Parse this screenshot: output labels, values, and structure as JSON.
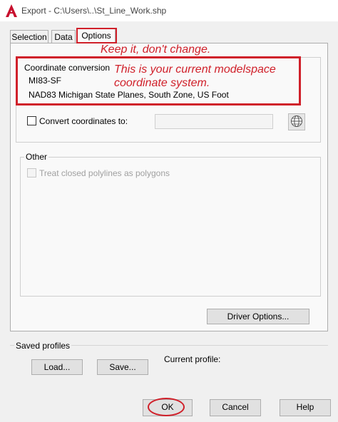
{
  "window": {
    "title": "Export - C:\\Users\\..\\St_Line_Work.shp"
  },
  "tabs": [
    {
      "label": "Selection"
    },
    {
      "label": "Data"
    },
    {
      "label": "Options",
      "selected": true
    }
  ],
  "coordinate_conversion": {
    "label": "Coordinate conversion",
    "code": "MI83-SF",
    "name": "NAD83 Michigan State Planes, South Zone, US Foot",
    "convert_checkbox_label": "Convert coordinates to:",
    "convert_checked": false,
    "convert_value": ""
  },
  "other": {
    "label": "Other",
    "polygons_label": "Treat closed polylines as polygons",
    "polygons_checked": false
  },
  "driver_options_label": "Driver Options...",
  "saved_profiles": {
    "label": "Saved profiles",
    "load_label": "Load...",
    "save_label": "Save...",
    "current_profile_label": "Current profile:"
  },
  "buttons": {
    "ok": "OK",
    "cancel": "Cancel",
    "help": "Help"
  },
  "annotations": {
    "keep": "Keep it, don't change.",
    "current_line1": "This is your current modelspace",
    "current_line2": "coordinate system."
  },
  "colors": {
    "annotation_red": "#d0202a",
    "app_icon_red": "#c8102e"
  },
  "icons": {
    "app": "autocad-icon",
    "globe": "globe-icon"
  }
}
